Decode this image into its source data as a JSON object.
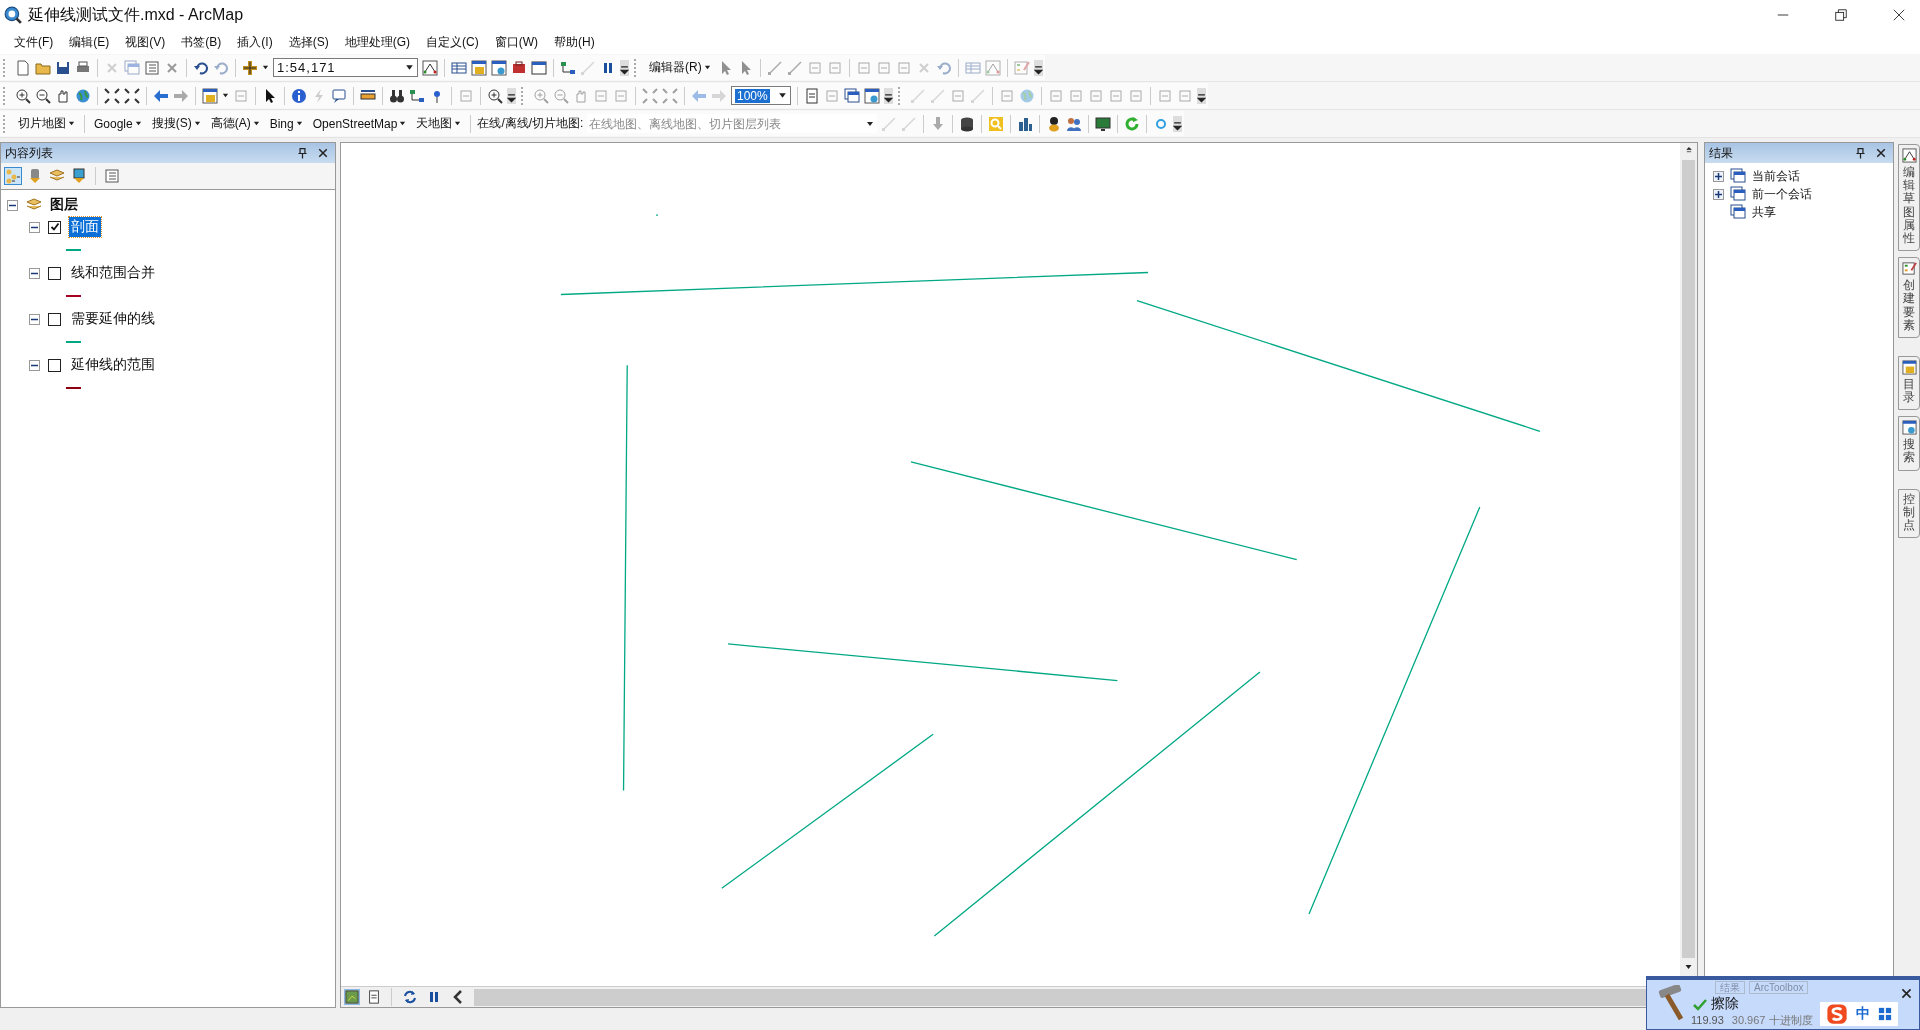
{
  "window": {
    "title": "延伸线测试文件.mxd - ArcMap"
  },
  "menu": [
    "文件(F)",
    "编辑(E)",
    "视图(V)",
    "书签(B)",
    "插入(I)",
    "选择(S)",
    "地理处理(G)",
    "自定义(C)",
    "窗口(W)",
    "帮助(H)"
  ],
  "standard_toolbar": {
    "scale": "1:54,171",
    "editor_menu": "编辑器(R)"
  },
  "layout_toolbar": {
    "zoom_percent": "100%"
  },
  "tile_toolbar": {
    "menus": [
      "切片地图",
      "Google",
      "搜搜(S)",
      "高德(A)",
      "Bing",
      "OpenStreetMap",
      "天地图"
    ],
    "label": "在线/离线/切片地图:",
    "placeholder": "在线地图、离线地图、切片图层列表"
  },
  "toc": {
    "title": "内容列表",
    "tree": [
      {
        "label": "图层",
        "expanded": true,
        "children": [
          {
            "label": "剖面",
            "checked": true,
            "selected": true,
            "expanded": true,
            "color": "#00a884"
          },
          {
            "label": "线和范围合并",
            "checked": false,
            "selected": false,
            "expanded": true,
            "color": "#a80020"
          },
          {
            "label": "需要延伸的线",
            "checked": false,
            "selected": false,
            "expanded": true,
            "color": "#00a884"
          },
          {
            "label": "延伸线的范围",
            "checked": false,
            "selected": false,
            "expanded": true,
            "color": "#8c0010"
          }
        ]
      }
    ]
  },
  "results": {
    "title": "结果",
    "items": [
      {
        "label": "当前会话",
        "kind": "folder",
        "expanded": false
      },
      {
        "label": "前一个会话",
        "kind": "folder",
        "expanded": false
      },
      {
        "label": "共享",
        "kind": "leaf",
        "expanded": false
      }
    ]
  },
  "side_tabs": [
    "编辑草图属性",
    "创建要素",
    "目录",
    "搜索",
    "控制点"
  ],
  "map_view": {
    "view_buttons": [
      {
        "kind": "data",
        "selected": true
      },
      {
        "kind": "layout",
        "selected": false
      }
    ]
  },
  "tool_window": {
    "tabs": [
      "结果",
      "ArcToolbox"
    ],
    "message": "擦除",
    "status": "119.93",
    "coordinates": "30.967 十进制度"
  },
  "ime": {
    "mode": "中"
  }
}
